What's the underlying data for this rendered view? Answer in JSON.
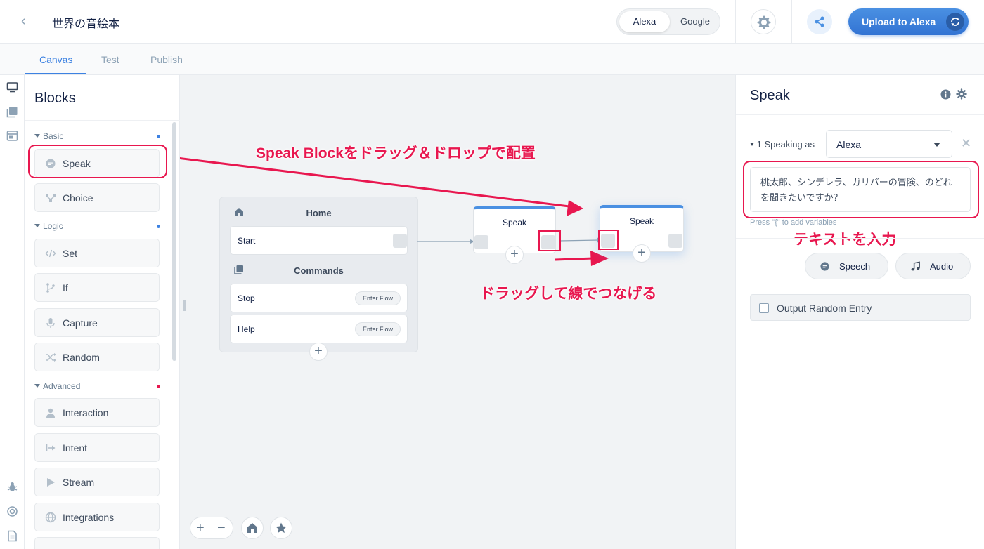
{
  "header": {
    "back_glyph": "‹",
    "project_title": "世界の音絵本",
    "platforms": [
      "Alexa",
      "Google"
    ],
    "selected_platform": "Alexa",
    "upload_label": "Upload to Alexa"
  },
  "tabs": [
    {
      "label": "Canvas",
      "active": true
    },
    {
      "label": "Test",
      "active": false
    },
    {
      "label": "Publish",
      "active": false
    }
  ],
  "rail_icons": [
    "monitor-icon",
    "library-icon",
    "window-icon",
    "bug-icon",
    "help-ring-icon",
    "document-icon"
  ],
  "blocks_panel": {
    "title": "Blocks",
    "sections": [
      {
        "name": "Basic",
        "dot_color": "#3d82e2",
        "items": [
          {
            "label": "Speak",
            "icon": "chat-bubble-icon"
          },
          {
            "label": "Choice",
            "icon": "branch-icon"
          }
        ]
      },
      {
        "name": "Logic",
        "dot_color": "#3d82e2",
        "items": [
          {
            "label": "Set",
            "icon": "code-icon"
          },
          {
            "label": "If",
            "icon": "fork-icon"
          },
          {
            "label": "Capture",
            "icon": "mic-icon"
          },
          {
            "label": "Random",
            "icon": "shuffle-icon"
          }
        ]
      },
      {
        "name": "Advanced",
        "dot_color": "#e8174f",
        "items": [
          {
            "label": "Interaction",
            "icon": "person-icon"
          },
          {
            "label": "Intent",
            "icon": "arrow-right-bar-icon"
          },
          {
            "label": "Stream",
            "icon": "play-icon"
          },
          {
            "label": "Integrations",
            "icon": "globe-icon"
          }
        ]
      }
    ]
  },
  "canvas": {
    "home_card": {
      "title": "Home",
      "start_label": "Start",
      "commands_title": "Commands",
      "commands": [
        {
          "label": "Stop",
          "action": "Enter Flow"
        },
        {
          "label": "Help",
          "action": "Enter Flow"
        }
      ],
      "add_glyph": "+"
    },
    "nodes": [
      {
        "title": "Speak",
        "add_glyph": "+"
      },
      {
        "title": "Speak",
        "add_glyph": "+"
      }
    ],
    "annotations": {
      "drag_drop": "Speak Blockをドラッグ＆ドロップで配置",
      "connect": "ドラッグして線でつなげる",
      "enter_text": "テキストを入力"
    },
    "annotation_color": "#e8174f",
    "zoom_controls": [
      {
        "glyph": "+",
        "name": "zoom-in-button"
      },
      {
        "glyph": "−",
        "name": "zoom-out-button"
      }
    ]
  },
  "right_panel": {
    "title": "Speak",
    "speaking_as_label": "1 Speaking as",
    "speaking_as_value": "Alexa",
    "close_glyph": "✕",
    "speech_text": "桃太郎、シンデレラ、ガリバーの冒険、のどれを聞きたいですか？",
    "hint": "Press \"{\" to add variables",
    "buttons": [
      {
        "label": "Speech",
        "icon": "chat-bubble-icon"
      },
      {
        "label": "Audio",
        "icon": "music-note-icon"
      }
    ],
    "output_random_label": "Output Random Entry",
    "output_random_checked": false
  },
  "colors": {
    "accent": "#3d82e2",
    "annotation": "#e8174f",
    "canvas_bg": "#f1f3f5"
  }
}
